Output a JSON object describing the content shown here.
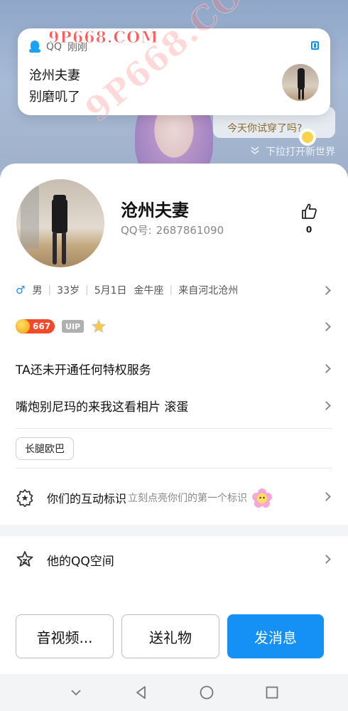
{
  "watermark": {
    "top": "9P668.COM",
    "diagonal": "9P668.COM"
  },
  "banner": {
    "speech_text": "今天你试穿了吗?",
    "pulldown_label": "下拉打开新世界",
    "pulldown_icon": "double-chevron-down-icon"
  },
  "notification": {
    "app_name": "QQ",
    "time": "刚刚",
    "sender": "沧州夫妻",
    "message": "别磨叽了"
  },
  "profile": {
    "nickname": "沧州夫妻",
    "qq_label": "QQ号:",
    "qq_number": "2687861090",
    "likes": "0",
    "gender_icon": "male-icon",
    "info": [
      "男",
      "33岁",
      "5月1日",
      "金牛座",
      "来自河北沧州"
    ],
    "level": "667",
    "vip_label": "UIP",
    "no_privilege": "TA还未开通任何特权服务",
    "signature": "嘴炮别尼玛的来我这看相片 滚蛋",
    "tag": "长腿欧巴",
    "interaction_title": "你们的互动标识",
    "interaction_hint": "立刻点亮你们的第一个标识",
    "space_title": "他的QQ空间"
  },
  "actions": {
    "av": "音视频...",
    "gift": "送礼物",
    "send": "发消息"
  },
  "colors": {
    "primary": "#1590f5",
    "male": "#2b8de0",
    "level_badge": "#f04a2a"
  }
}
